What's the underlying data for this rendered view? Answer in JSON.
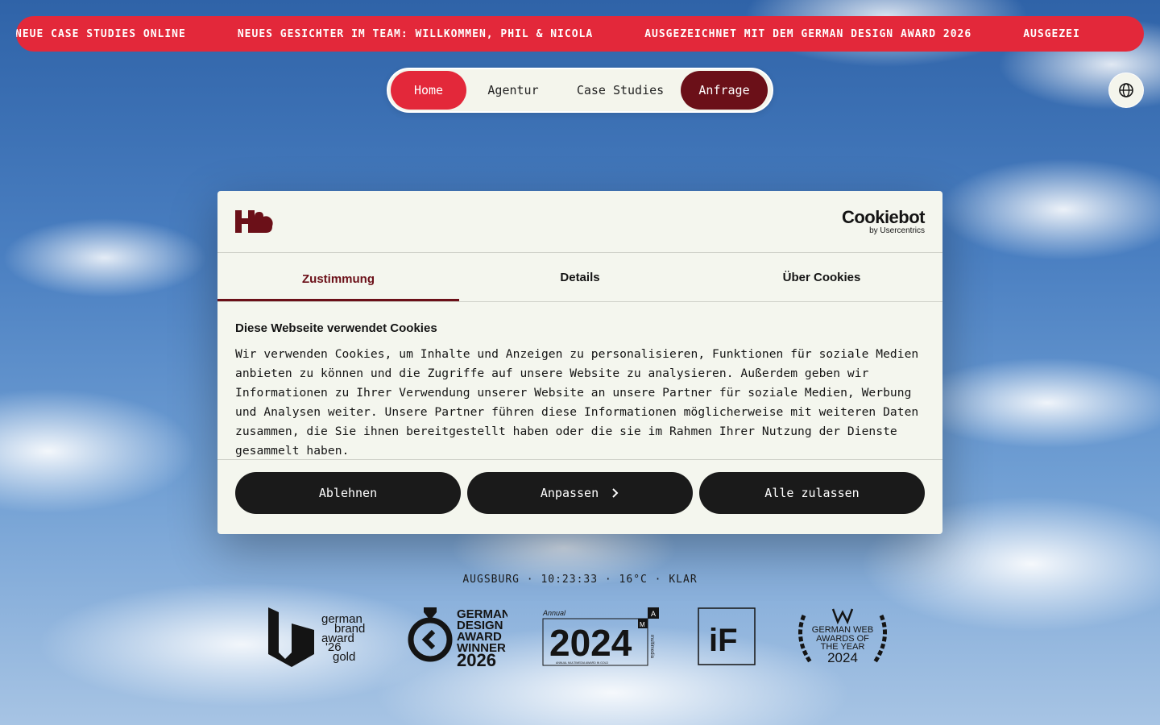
{
  "ticker": {
    "items": [
      "NEUE CASE STUDIES ONLINE",
      "NEUES GESICHTER IM TEAM: WILLKOMMEN, PHIL & NICOLA",
      "AUSGEZEICHNET MIT DEM GERMAN DESIGN AWARD 2026",
      "AUSGEZEI"
    ]
  },
  "nav": {
    "home": "Home",
    "agentur": "Agentur",
    "case_studies": "Case Studies",
    "anfrage": "Anfrage"
  },
  "language_icon": "globe-icon",
  "cookie_dialog": {
    "provider_main": "Cookiebot",
    "provider_sub": "by Usercentrics",
    "tabs": [
      "Zustimmung",
      "Details",
      "Über Cookies"
    ],
    "active_tab": "Zustimmung",
    "title": "Diese Webseite verwendet Cookies",
    "text": "Wir verwenden Cookies, um Inhalte und Anzeigen zu personalisieren, Funktionen für soziale Medien anbieten zu können und die Zugriffe auf unsere Website zu analysieren. Außerdem geben wir Informationen zu Ihrer Verwendung unserer Website an unsere Partner für soziale Medien, Werbung und Analysen weiter. Unsere Partner führen diese Informationen möglicherweise mit weiteren Daten zusammen, die Sie ihnen bereitgestellt haben oder die sie im Rahmen Ihrer Nutzung der Dienste gesammelt haben.",
    "buttons": {
      "decline": "Ablehnen",
      "customize": "Anpassen",
      "accept_all": "Alle zulassen"
    }
  },
  "weather": "AUGSBURG · 10:23:33 · 16°C · KLAR",
  "awards": {
    "brand_award": [
      "german",
      "brand",
      "award",
      "'26",
      "gold"
    ],
    "design_award": [
      "GERMAN",
      "DESIGN",
      "AWARD",
      "WINNER",
      "2026"
    ],
    "annual": [
      "Annual",
      "2024",
      "A",
      "M",
      "multimedia",
      "ANNUAL MULTIMEDIA AWARD IN GOLD"
    ],
    "if_award": "iF",
    "web_awards": [
      "GERMAN WEB",
      "AWARDS OF",
      "THE YEAR",
      "2024"
    ]
  },
  "colors": {
    "ticker_red": "#e3283a",
    "brand_dark_red": "#6b1018",
    "dialog_bg": "#f4f6ee",
    "button_dark": "#1a1a1a"
  }
}
